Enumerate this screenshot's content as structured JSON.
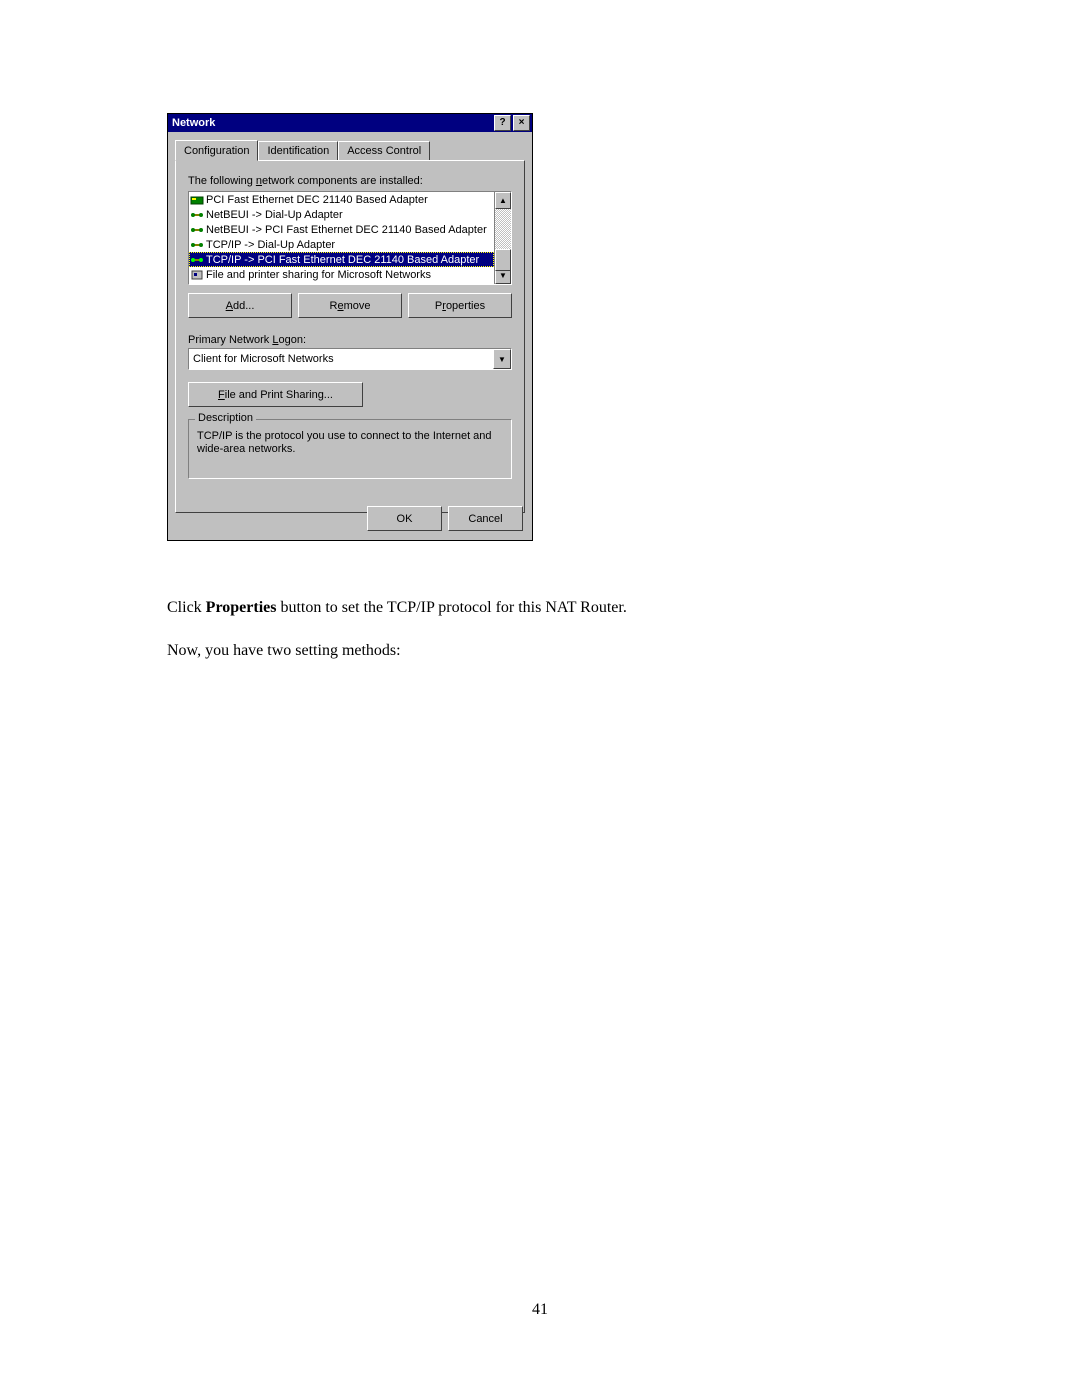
{
  "dialog": {
    "title": "Network",
    "help_btn": "?",
    "close_btn": "×",
    "tabs": [
      "Configuration",
      "Identification",
      "Access Control"
    ],
    "active_tab": 0,
    "components_label_pre": "The following ",
    "components_label_u": "n",
    "components_label_post": "etwork components are installed:",
    "items": [
      {
        "icon": "adapter",
        "text": "PCI Fast Ethernet DEC 21140 Based Adapter",
        "selected": false
      },
      {
        "icon": "protocol",
        "text": "NetBEUI -> Dial-Up Adapter",
        "selected": false
      },
      {
        "icon": "protocol",
        "text": "NetBEUI -> PCI Fast Ethernet DEC 21140 Based Adapter",
        "selected": false
      },
      {
        "icon": "protocol",
        "text": "TCP/IP -> Dial-Up Adapter",
        "selected": false
      },
      {
        "icon": "protocol",
        "text": "TCP/IP -> PCI Fast Ethernet DEC 21140 Based Adapter",
        "selected": true
      },
      {
        "icon": "service",
        "text": "File and printer sharing for Microsoft Networks",
        "selected": false
      }
    ],
    "add_u": "A",
    "add_post": "dd...",
    "remove_pre": "R",
    "remove_u": "e",
    "remove_post": "move",
    "props_pre": "P",
    "props_u": "r",
    "props_post": "operties",
    "primary_logon_pre": "Primary Network ",
    "primary_logon_u": "L",
    "primary_logon_post": "ogon:",
    "primary_logon_value": "Client for Microsoft Networks",
    "fps_u": "F",
    "fps_post": "ile and Print Sharing...",
    "desc_title": "Description",
    "desc_text": "TCP/IP is the protocol you use to connect to the Internet and wide-area networks.",
    "ok": "OK",
    "cancel": "Cancel"
  },
  "body": {
    "line1_pre": "Click ",
    "line1_bold": "Properties",
    "line1_post": " button to set the TCP/IP protocol for this NAT Router.",
    "line2": "Now, you have two setting methods:"
  },
  "page_number": "41"
}
